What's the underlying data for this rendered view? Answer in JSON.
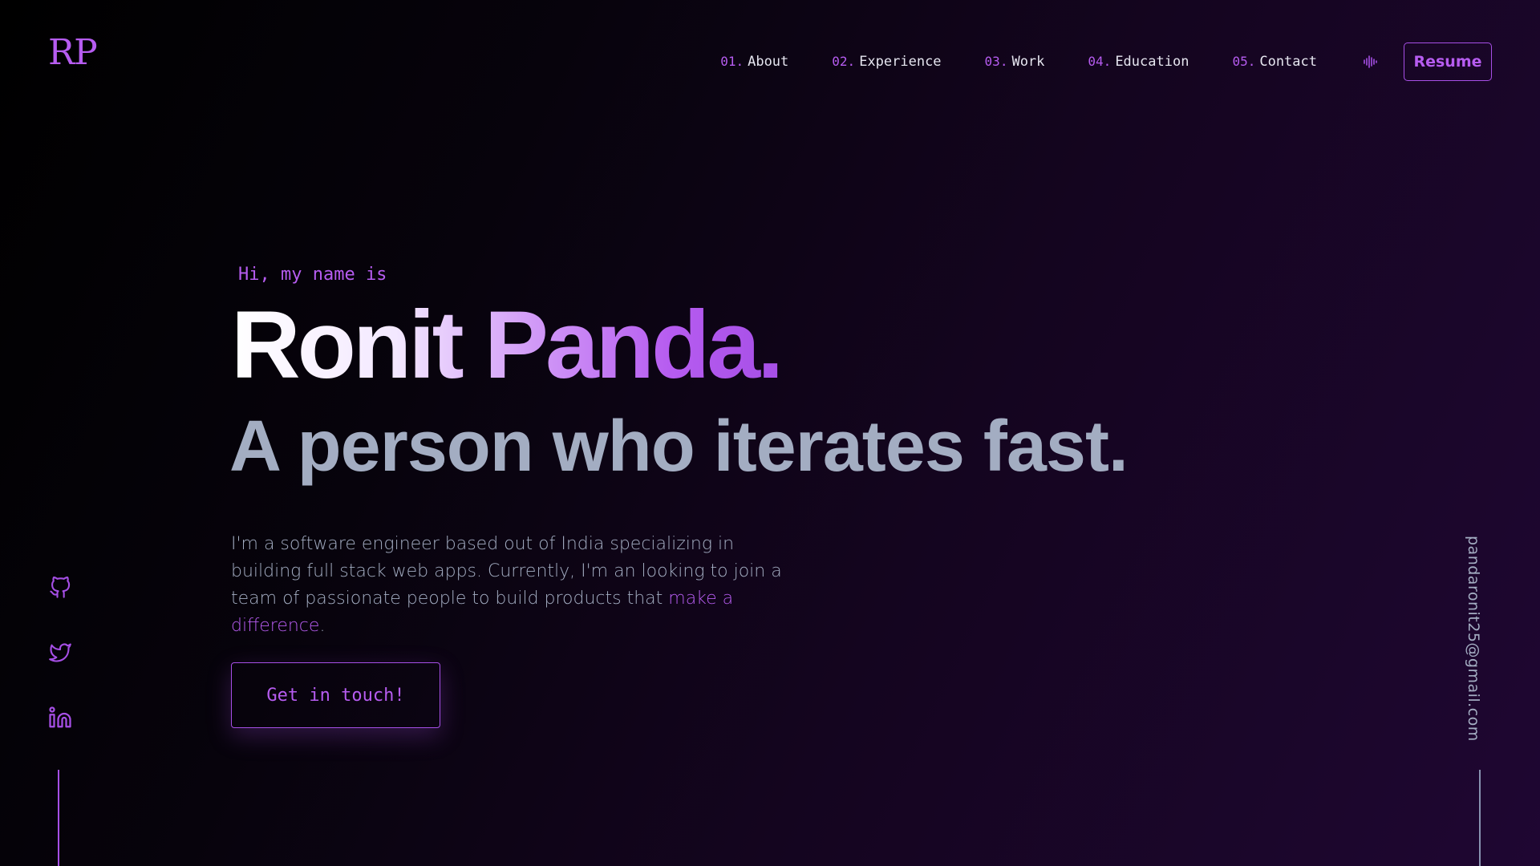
{
  "header": {
    "logo": "RP",
    "nav": [
      {
        "num": "01.",
        "label": "About"
      },
      {
        "num": "02.",
        "label": "Experience"
      },
      {
        "num": "03.",
        "label": "Work"
      },
      {
        "num": "04.",
        "label": "Education"
      },
      {
        "num": "05.",
        "label": "Contact"
      }
    ],
    "sound_icon": "sound-wave-icon",
    "resume_label": "Resume"
  },
  "hero": {
    "greeting": "Hi, my name is",
    "name": "Ronit Panda.",
    "tagline": "A person who iterates fast.",
    "description_text": "I'm a software engineer based out of India specializing in building full stack web apps. Currently, I'm an looking to join a team of passionate people to build products that ",
    "description_highlight": "make a difference",
    "description_end": ".",
    "cta_label": "Get in touch!"
  },
  "socials": [
    {
      "icon": "github-icon"
    },
    {
      "icon": "twitter-icon"
    },
    {
      "icon": "linkedin-icon"
    }
  ],
  "email": "pandaronit25@gmail.com",
  "colors": {
    "accent": "#b65cf0",
    "text_muted": "#a3adc2",
    "text_light": "#e6e6f0",
    "background_dark": "#000000",
    "background_purple": "#1f0632"
  }
}
